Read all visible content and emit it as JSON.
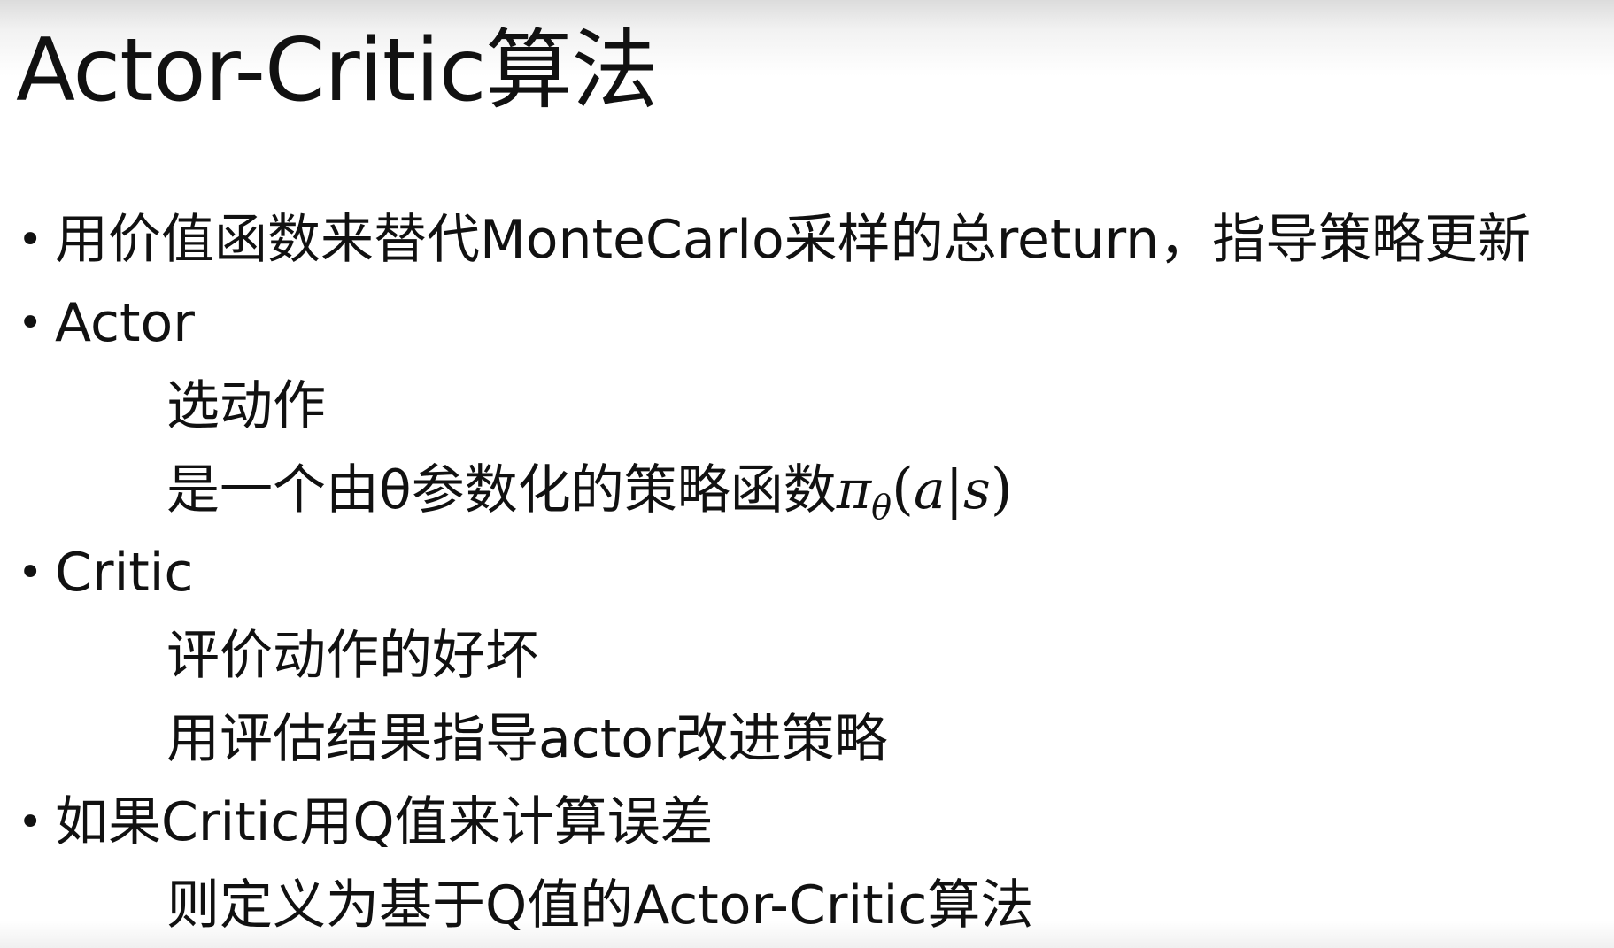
{
  "title": "Actor-Critic算法",
  "bullets": [
    {
      "marker": "•",
      "text": "用价值函数来替代MonteCarlo采样的总return，指导策略更新",
      "sub": []
    },
    {
      "marker": "•",
      "text": "Actor",
      "sub": [
        "选动作",
        "是一个由θ参数化的策略函数"
      ]
    },
    {
      "marker": "•",
      "text": "Critic",
      "sub": [
        "评价动作的好坏",
        "用评估结果指导actor改进策略"
      ]
    },
    {
      "marker": "•",
      "text": "如果Critic用Q值来计算误差",
      "sub": [
        "则定义为基于Q值的Actor-Critic算法"
      ]
    }
  ],
  "math": {
    "func": "π",
    "subscript": "θ",
    "open": "(",
    "args": "a|s",
    "close": ")"
  }
}
